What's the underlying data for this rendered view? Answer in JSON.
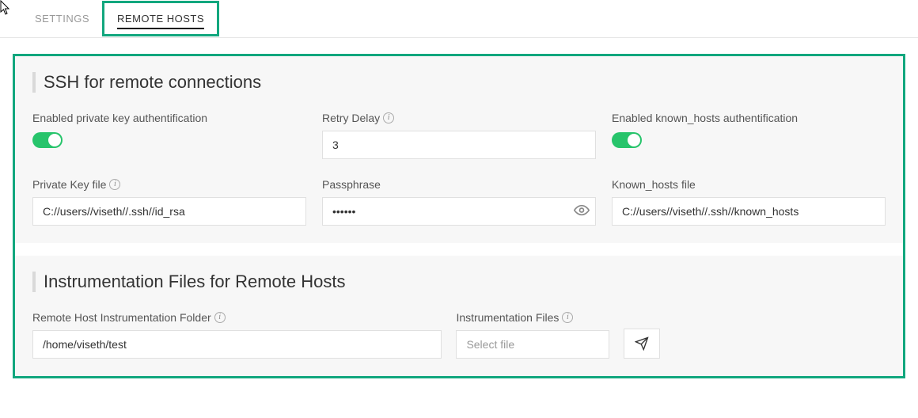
{
  "tabs": {
    "settings": "SETTINGS",
    "remote_hosts": "REMOTE HOSTS"
  },
  "ssh": {
    "title": "SSH for remote connections",
    "enabled_pk_label": "Enabled private key authentification",
    "retry_delay_label": "Retry Delay",
    "retry_delay_value": "3",
    "enabled_kh_label": "Enabled known_hosts authentification",
    "private_key_label": "Private Key file",
    "private_key_value": "C://users//viseth//.ssh//id_rsa",
    "passphrase_label": "Passphrase",
    "passphrase_value": "••••••",
    "known_hosts_label": "Known_hosts file",
    "known_hosts_value": "C://users//viseth//.ssh//known_hosts"
  },
  "instr": {
    "title": "Instrumentation Files for Remote Hosts",
    "folder_label": "Remote Host Instrumentation Folder",
    "folder_value": "/home/viseth/test",
    "files_label": "Instrumentation Files",
    "files_placeholder": "Select file"
  }
}
